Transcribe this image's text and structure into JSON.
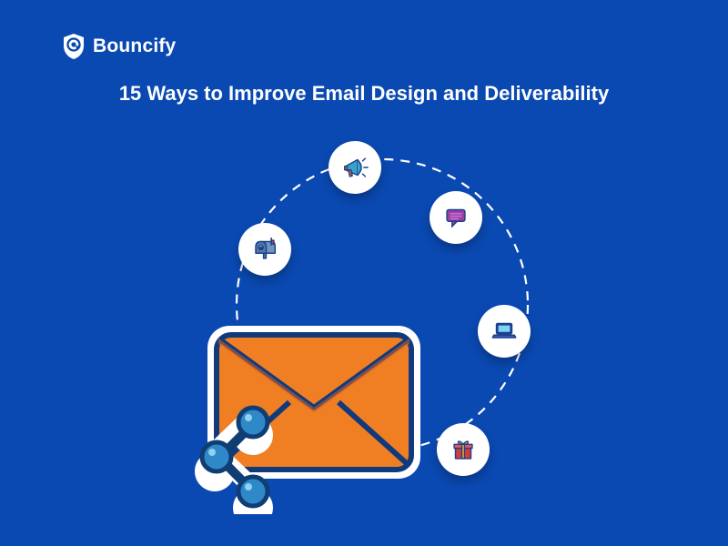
{
  "brand": {
    "name": "Bouncify"
  },
  "title": "15 Ways to Improve Email Design and Deliverability",
  "colors": {
    "bg": "#0a49b1",
    "white": "#ffffff",
    "envelope_body": "#f07f23",
    "envelope_flap": "#e5671e",
    "envelope_outline": "#113a7c",
    "share_node": "#2f89c9",
    "share_outline": "#0f3d74",
    "bubble_icon_stroke": "#1b3f8a",
    "megaphone": "#3aa2c9",
    "chat": "#9b3fa6",
    "laptop": "#3a5ac2",
    "laptop_screen": "#7dd4f2",
    "gift_body": "#d63a3a",
    "gift_ribbon": "#f2c238",
    "mailbox": "#537aa6"
  },
  "bubbles": [
    {
      "name": "megaphone-icon"
    },
    {
      "name": "chat-icon"
    },
    {
      "name": "mailbox-icon"
    },
    {
      "name": "laptop-icon"
    },
    {
      "name": "gift-icon"
    }
  ]
}
